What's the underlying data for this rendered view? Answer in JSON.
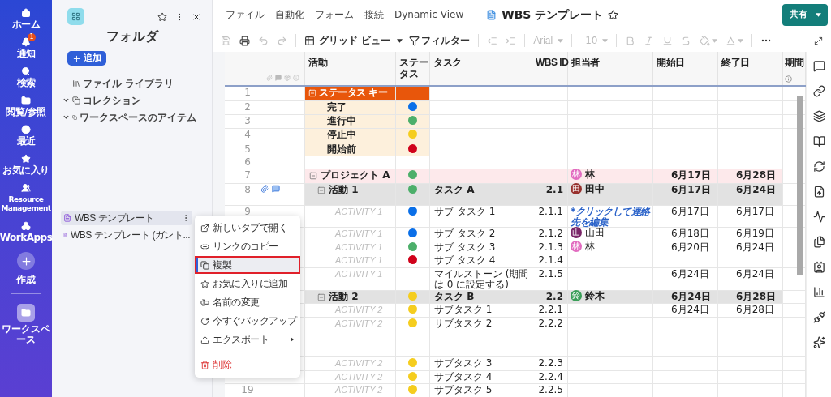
{
  "nav": {
    "items": [
      {
        "label": "ホーム",
        "kind": "link",
        "selected": false
      },
      {
        "label": "通知",
        "kind": "link",
        "badge": "1",
        "selected": false
      },
      {
        "label": "検索",
        "kind": "link",
        "selected": false
      },
      {
        "label": "閲覧/参照",
        "kind": "link",
        "selected": false
      },
      {
        "label": "最近",
        "kind": "link",
        "selected": false
      },
      {
        "label": "お気に入り",
        "kind": "link",
        "selected": false
      },
      {
        "label": "Resource Management",
        "kind": "link",
        "selected": false
      },
      {
        "label": "WorkApps",
        "kind": "link",
        "selected": false
      },
      {
        "label": "作成",
        "kind": "create",
        "selected": false
      },
      {
        "label": "ワークスペース",
        "kind": "workspace",
        "selected": true
      }
    ]
  },
  "folder_panel": {
    "title": "フォルダ",
    "add_button": "追加",
    "favorite": false,
    "tree": [
      {
        "label": "ファイル ライブラリ"
      },
      {
        "label": "コレクション",
        "expanded": true
      },
      {
        "label": "ワークスペースのアイテム",
        "expanded": true
      }
    ],
    "sheets": [
      {
        "label": "WBS テンプレート",
        "selected": true
      },
      {
        "label": "WBS テンプレート (ガント...",
        "selected": false
      }
    ]
  },
  "menu_bar": [
    "ファイル",
    "自動化",
    "フォーム",
    "接続",
    "Dynamic View"
  ],
  "sheet_title": {
    "text": "WBS テンプレート",
    "favorite": false
  },
  "share_button": "共有",
  "toolbar": {
    "history": [
      {
        "kind": "save",
        "disabled": true
      },
      {
        "kind": "print",
        "disabled": false
      },
      {
        "kind": "undo",
        "disabled": true
      },
      {
        "kind": "redo",
        "disabled": true
      }
    ],
    "view": "グリッド ビュー",
    "filter": "フィルター",
    "indent": [
      {
        "kind": "outdent",
        "disabled": true
      },
      {
        "kind": "indent",
        "disabled": true
      }
    ],
    "font": {
      "label": "Arial",
      "disabled": true
    },
    "font_size": {
      "label": "10",
      "disabled": true
    },
    "format": [
      {
        "kind": "bold",
        "disabled": true
      },
      {
        "kind": "italic",
        "disabled": true
      },
      {
        "kind": "underline",
        "disabled": true
      },
      {
        "kind": "strike",
        "disabled": true
      },
      {
        "kind": "fill",
        "disabled": true
      },
      {
        "kind": "text_color",
        "disabled": true
      }
    ]
  },
  "grid": {
    "columns": [
      "活動",
      "ステータス",
      "タスク",
      "WBS ID",
      "担当者",
      "開始日",
      "終了日",
      "期間"
    ],
    "rows": [
      {
        "number": "1",
        "kind": "key_header",
        "expanded": true,
        "activity": "ステータス キー",
        "attachment": false,
        "comment": false
      },
      {
        "number": "2",
        "kind": "key",
        "activity": "完了",
        "color": "#0a6fe8",
        "attachment": false,
        "comment": false
      },
      {
        "number": "3",
        "kind": "key",
        "activity": "進行中",
        "color": "#4caf6a",
        "attachment": false,
        "comment": false
      },
      {
        "number": "4",
        "kind": "key",
        "activity": "停止中",
        "color": "#f5cd1e",
        "attachment": false,
        "comment": false
      },
      {
        "number": "5",
        "kind": "key",
        "activity": "開始前",
        "color": "#d0021b",
        "attachment": false,
        "comment": false
      },
      {
        "number": "6",
        "kind": "blank",
        "attachment": false,
        "comment": false
      },
      {
        "number": "7",
        "kind": "project",
        "expanded": true,
        "activity": "プロジェクト A",
        "color": "#4caf6a",
        "assignee": {
          "kind": "person",
          "initial": "林",
          "name": "林",
          "color": "#e26cc0"
        },
        "start": "6月17日",
        "end": "6月28日",
        "attachment": false,
        "comment": false
      },
      {
        "number": "8",
        "kind": "activity",
        "expanded": true,
        "activity": "活動 1",
        "color": "#4caf6a",
        "task": "タスク A",
        "wbs": "2.1",
        "assignee": {
          "kind": "person",
          "initial": "田",
          "name": "田中",
          "color": "#98312e"
        },
        "start": "6月17日",
        "end": "6月24日",
        "attachment": true,
        "comment": true
      },
      {
        "number": "9",
        "kind": "subtask",
        "activity": "ACTIVITY 1",
        "color": "#0a6fe8",
        "task": "サブ タスク 1",
        "wbs": "2.1.1",
        "assignee": {
          "kind": "prompt",
          "text": "*クリックして連絡先を編集"
        },
        "start": "6月17日",
        "end": "6月17日",
        "attachment": false,
        "comment": false
      },
      {
        "kind": "subtask",
        "activity": "ACTIVITY 1",
        "color": "#0a6fe8",
        "task": "サブ タスク 2",
        "wbs": "2.1.2",
        "assignee": {
          "kind": "person",
          "initial": "山",
          "name": "山田",
          "color": "#7a2668"
        },
        "start": "6月18日",
        "end": "6月19日"
      },
      {
        "kind": "subtask",
        "activity": "ACTIVITY 1",
        "color": "#4caf6a",
        "task": "サブ タスク 3",
        "wbs": "2.1.3",
        "assignee": {
          "kind": "person",
          "initial": "林",
          "name": "林",
          "color": "#e26cc0"
        },
        "start": "6月20日",
        "end": "6月24日"
      },
      {
        "kind": "subtask",
        "activity": "ACTIVITY 1",
        "color": "#d0021b",
        "task": "サブ タスク 4",
        "wbs": "2.1.4"
      },
      {
        "kind": "subtask",
        "activity": "ACTIVITY 1",
        "task": "マイルストーン (期間は 0 に設定する)",
        "wbs": "2.1.5",
        "start": "6月24日",
        "end": "6月24日"
      },
      {
        "kind": "activity",
        "expanded": true,
        "activity": "活動 2",
        "color": "#f5cd1e",
        "task": "タスク B",
        "wbs": "2.2",
        "assignee": {
          "kind": "person",
          "initial": "鈴",
          "name": "鈴木",
          "color": "#3a9e58"
        },
        "start": "6月24日",
        "end": "6月28日"
      },
      {
        "kind": "subtask",
        "activity": "ACTIVITY 2",
        "color": "#f5cd1e",
        "task": "サブタスク 1",
        "wbs": "2.2.1",
        "start": "6月24日",
        "end": "6月28日"
      },
      {
        "kind": "subtask",
        "activity": "ACTIVITY 2",
        "color": "#f5cd1e",
        "task": "サブタスク 2",
        "wbs": "2.2.2"
      },
      {
        "kind": "subtask",
        "activity": "ACTIVITY 2",
        "color": "#f5cd1e",
        "task": "サブタスク 3",
        "wbs": "2.2.3"
      },
      {
        "kind": "subtask",
        "activity": "ACTIVITY 2",
        "color": "#f5cd1e",
        "task": "サブタスク 4",
        "wbs": "2.2.4"
      },
      {
        "number": "19",
        "kind": "subtask",
        "activity": "ACTIVITY 2",
        "color": "#f5cd1e",
        "task": "サブタスク 5",
        "wbs": "2.2.5",
        "attachment": false,
        "comment": false
      }
    ]
  },
  "context_menu": {
    "items": [
      {
        "label": "新しいタブで開く",
        "kind": "normal",
        "selected": false
      },
      {
        "label": "リンクのコピー",
        "kind": "normal",
        "selected": false
      },
      {
        "label": "複製",
        "kind": "normal",
        "selected": true
      },
      {
        "label": "お気に入りに追加",
        "kind": "normal",
        "selected": false
      },
      {
        "label": "名前の変更",
        "kind": "normal",
        "selected": false
      },
      {
        "label": "今すぐバックアップ",
        "kind": "normal",
        "selected": false
      },
      {
        "label": "エクスポート",
        "kind": "submenu",
        "selected": false
      },
      {
        "label": "削除",
        "kind": "danger",
        "selected": false
      }
    ]
  }
}
